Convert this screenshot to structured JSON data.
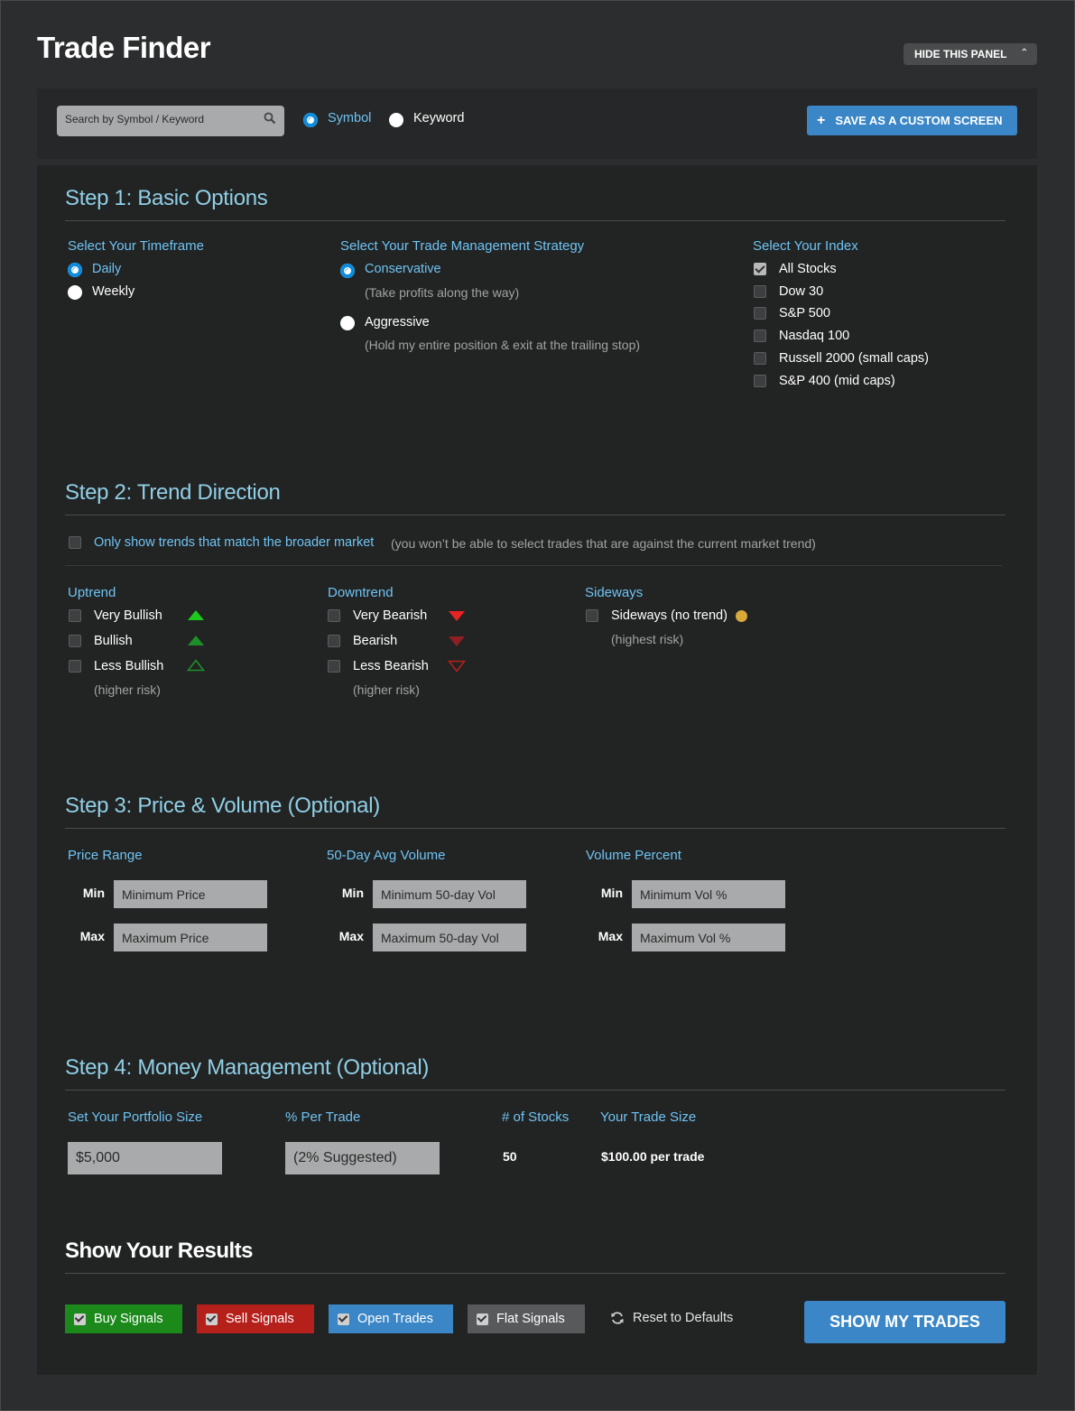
{
  "app": {
    "title": "Trade Finder",
    "hide_panel_label": "HIDE THIS PANEL"
  },
  "search": {
    "placeholder": "Search by Symbol / Keyword",
    "mode_options": [
      {
        "label": "Symbol",
        "selected": true
      },
      {
        "label": "Keyword",
        "selected": false
      }
    ],
    "save_label": "SAVE AS A CUSTOM SCREEN"
  },
  "step1": {
    "title": "Step 1: Basic Options",
    "timeframe": {
      "label": "Select Your Timeframe",
      "options": [
        {
          "label": "Daily",
          "selected": true
        },
        {
          "label": "Weekly",
          "selected": false
        }
      ]
    },
    "strategy": {
      "label": "Select Your Trade Management Strategy",
      "options": [
        {
          "label": "Conservative",
          "note": "(Take profits along the way)",
          "selected": true
        },
        {
          "label": "Aggressive",
          "note": "(Hold my entire position & exit at the trailing stop)",
          "selected": false
        }
      ]
    },
    "index": {
      "label": "Select Your Index",
      "options": [
        {
          "label": "All Stocks",
          "checked": true
        },
        {
          "label": "Dow 30",
          "checked": false
        },
        {
          "label": "S&P 500",
          "checked": false
        },
        {
          "label": "Nasdaq 100",
          "checked": false
        },
        {
          "label": "Russell 2000 (small caps)",
          "checked": false
        },
        {
          "label": "S&P 400 (mid caps)",
          "checked": false
        }
      ]
    }
  },
  "step2": {
    "title": "Step 2: Trend Direction",
    "match_market_label": "Only show trends that match the broader market",
    "match_market_note": "(you won’t be able to select trades that are against the current market trend)",
    "uptrend": {
      "label": "Uptrend",
      "options": [
        "Very Bullish",
        "Bullish",
        "Less Bullish"
      ],
      "note": "(higher risk)"
    },
    "downtrend": {
      "label": "Downtrend",
      "options": [
        "Very Bearish",
        "Bearish",
        "Less Bearish"
      ],
      "note": "(higher risk)"
    },
    "sideways": {
      "label": "Sideways",
      "options": [
        "Sideways (no trend)"
      ],
      "note": "(highest risk)"
    },
    "colors": {
      "bull": "#1ec81e",
      "bull_mid": "#1d8f2a",
      "bear": "#e82323",
      "bear_mid": "#8e1f23",
      "sideways": "#d9a93a"
    }
  },
  "step3": {
    "title": "Step 3: Price & Volume (Optional)",
    "min_label": "Min",
    "max_label": "Max",
    "groups": [
      {
        "label": "Price Range",
        "min_placeholder": "Minimum Price",
        "max_placeholder": "Maximum Price"
      },
      {
        "label": "50-Day Avg Volume",
        "min_placeholder": "Minimum 50-day Vol",
        "max_placeholder": "Maximum 50-day Vol"
      },
      {
        "label": "Volume Percent",
        "min_placeholder": "Minimum Vol %",
        "max_placeholder": "Maximum Vol %"
      }
    ]
  },
  "step4": {
    "title": "Step 4: Money Management (Optional)",
    "portfolio_label": "Set Your Portfolio Size",
    "portfolio_value": "$5,000",
    "per_trade_label": "% Per Trade",
    "per_trade_placeholder": "(2% Suggested)",
    "stocks_label": "# of Stocks",
    "stocks_value": "50",
    "trade_size_label": "Your Trade Size",
    "trade_size_value": "$100.00 per trade"
  },
  "results": {
    "title": "Show Your Results",
    "filters": [
      {
        "label": "Buy Signals",
        "color": "#1b8a1b"
      },
      {
        "label": "Sell Signals",
        "color": "#b5201b"
      },
      {
        "label": "Open Trades",
        "color": "#3a86c6"
      },
      {
        "label": "Flat Signals",
        "color": "#58595a"
      }
    ],
    "reset_label": "Reset to Defaults",
    "show_label": "SHOW MY TRADES"
  }
}
